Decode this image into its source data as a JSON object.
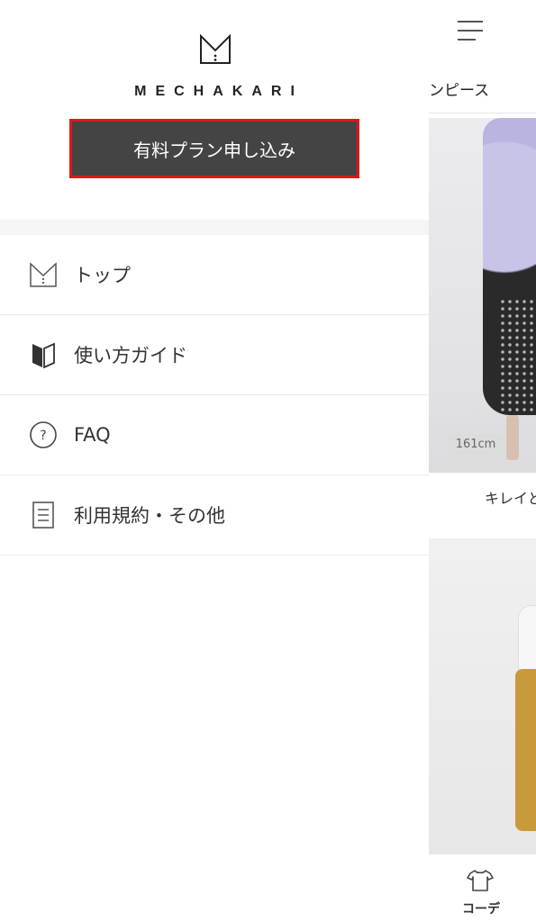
{
  "drawer": {
    "brand": "MECHAKARI",
    "logo_icon": "mechakari-logo-icon",
    "plan_button": "有料プラン申し込み",
    "menu": [
      {
        "label": "トップ",
        "icon": "box-icon"
      },
      {
        "label": "使い方ガイド",
        "icon": "book-icon"
      },
      {
        "label": "FAQ",
        "icon": "question-circle-icon"
      },
      {
        "label": "利用規約・その他",
        "icon": "document-icon"
      }
    ]
  },
  "background": {
    "menu_icon": "hamburger-icon",
    "category_tab": "ンピース",
    "item1_height_badge": "161cm",
    "item1_caption": "キレイど",
    "bottom_nav_label": "コーデ",
    "bottom_nav_icon": "tshirt-icon"
  },
  "colors": {
    "accent_border": "#d71a1a",
    "button_bg": "#444444",
    "separator": "#f5f5f5"
  }
}
